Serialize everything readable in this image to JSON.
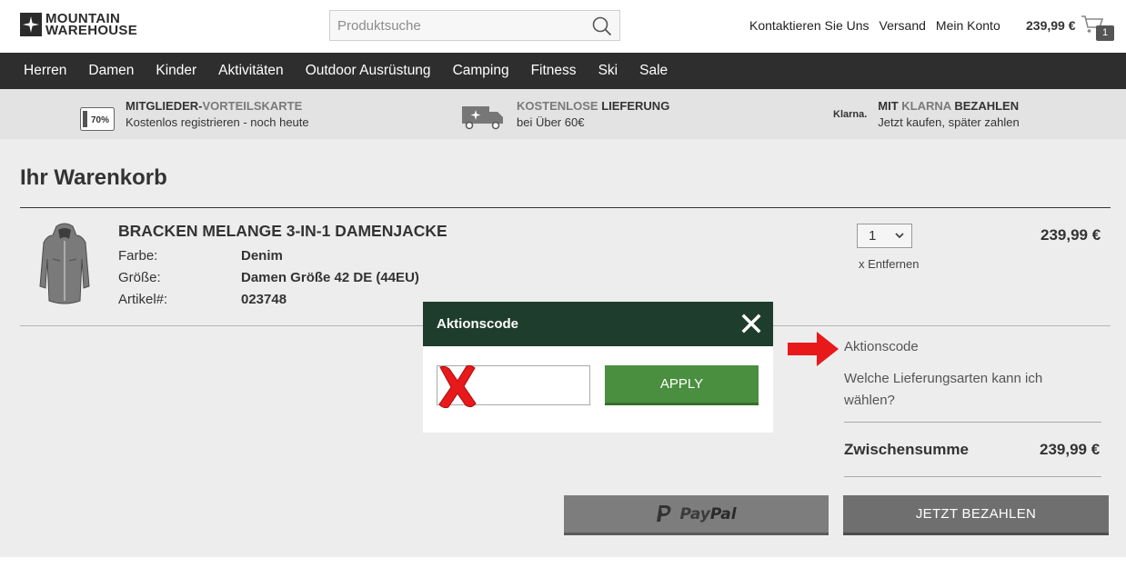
{
  "header": {
    "logo_line1": "MOUNTAIN",
    "logo_line2": "WAREHOUSE",
    "search_placeholder": "Produktsuche",
    "links": [
      "Kontaktieren Sie Uns",
      "Versand",
      "Mein Konto"
    ],
    "cart_total": "239,99 €",
    "cart_count": "1"
  },
  "nav": {
    "items": [
      "Herren",
      "Damen",
      "Kinder",
      "Aktivitäten",
      "Outdoor Ausrüstung",
      "Camping",
      "Fitness",
      "Ski",
      "Sale"
    ]
  },
  "promo": {
    "membership": {
      "title_bold": "MITGLIEDER-",
      "title_light": "VORTEILSKARTE",
      "subtitle": "Kostenlos registrieren - noch heute",
      "badge": "70%"
    },
    "delivery": {
      "title_light": "KOSTENLOSE ",
      "title_bold": "LIEFERUNG",
      "subtitle": "bei Über 60€"
    },
    "klarna": {
      "logo": "Klarna.",
      "title_bold1": "MIT ",
      "title_light": "KLARNA",
      "title_bold2": " BEZAHLEN",
      "subtitle": "Jetzt kaufen, später zahlen"
    }
  },
  "cart": {
    "title": "Ihr Warenkorb",
    "item": {
      "name": "BRACKEN MELANGE 3-IN-1 DAMENJACKE",
      "labels": {
        "color": "Farbe:",
        "size": "Größe:",
        "sku": "Artikel#:"
      },
      "values": {
        "color": "Denim",
        "size": "Damen Größe 42 DE (44EU)",
        "sku": "023748"
      },
      "quantity": "1",
      "remove_label": "x Entfernen",
      "price": "239,99 €"
    },
    "promo_code_link": "Aktionscode",
    "delivery_question": "Welche Lieferungsarten kann ich wählen?",
    "subtotal_label": "Zwischensumme",
    "subtotal_value": "239,99 €",
    "paypal_pay": "Pay",
    "paypal_pal": "Pal",
    "checkout_label": "JETZT BEZAHLEN"
  },
  "modal": {
    "title": "Aktionscode",
    "input_value": "",
    "apply_label": "APPLY"
  },
  "colors": {
    "nav_bg": "#2e2e2e",
    "modal_header": "#1f3d2d",
    "apply_button": "#4a8f3f",
    "arrow": "#e8191b",
    "x_mark": "#e8191b"
  }
}
